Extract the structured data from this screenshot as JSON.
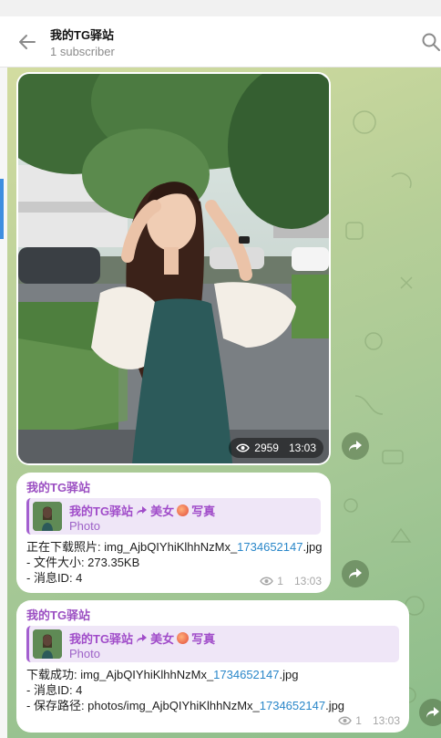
{
  "header": {
    "title": "我的TG驿站",
    "subtitle": "1 subscriber"
  },
  "photo_post": {
    "views": "2959",
    "time": "13:03"
  },
  "messages": [
    {
      "sender": "我的TG驿站",
      "forward_title_a": "我的TG驿站",
      "forward_title_b": "美女",
      "forward_title_c": "写真",
      "forward_sub": "Photo",
      "line1_prefix": "正在下载照片: img_AjbQIYhiKlhhNzMx_",
      "line1_link": "1734652147",
      "line1_suffix": ".jpg",
      "line2": "- 文件大小: 273.35KB",
      "line3": "- 消息ID: 4",
      "views": "1",
      "time": "13:03"
    },
    {
      "sender": "我的TG驿站",
      "forward_title_a": "我的TG驿站",
      "forward_title_b": "美女",
      "forward_title_c": "写真",
      "forward_sub": "Photo",
      "line1_prefix": "下载成功: img_AjbQIYhiKlhhNzMx_",
      "line1_link": "1734652147",
      "line1_suffix": ".jpg",
      "line2": "- 消息ID: 4",
      "line3_prefix": "- 保存路径: photos/img_AjbQIYhiKlhhNzMx_",
      "line3_link": "1734652147",
      "line3_suffix": ".jpg",
      "views": "1",
      "time": "13:03"
    }
  ],
  "colors": {
    "accent": "#9b4fc2",
    "link": "#2a87c9"
  }
}
